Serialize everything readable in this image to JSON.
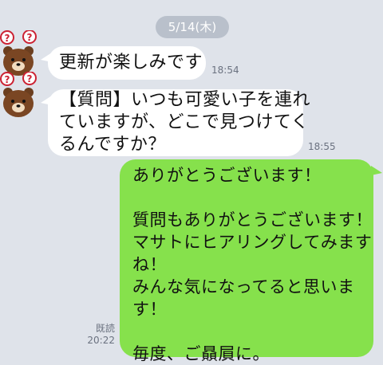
{
  "date_label": "5/14(木)",
  "messages": [
    {
      "text": "更新が楽しみです",
      "time": "18:54"
    },
    {
      "text": "【質問】いつも可愛い子を連れ\nていますが、どこで見つけてく\nるんですか？",
      "time": "18:55"
    }
  ],
  "reply": {
    "text": "ありがとうございます！\n\n質問もありがとうございます！\nマサトにヒアリングしてみます\nね！\nみんな気になってると思いま\nす！\n\n毎度、ご贔屓に。",
    "read_label": "既読",
    "time": "20:22"
  },
  "colors": {
    "background": "#dfe3ea",
    "incoming_bubble": "#ffffff",
    "outgoing_bubble": "#86e14c",
    "date_pill": "#b9c0cb"
  },
  "icons": {
    "avatar": "brown-bear-question-marks-icon"
  }
}
